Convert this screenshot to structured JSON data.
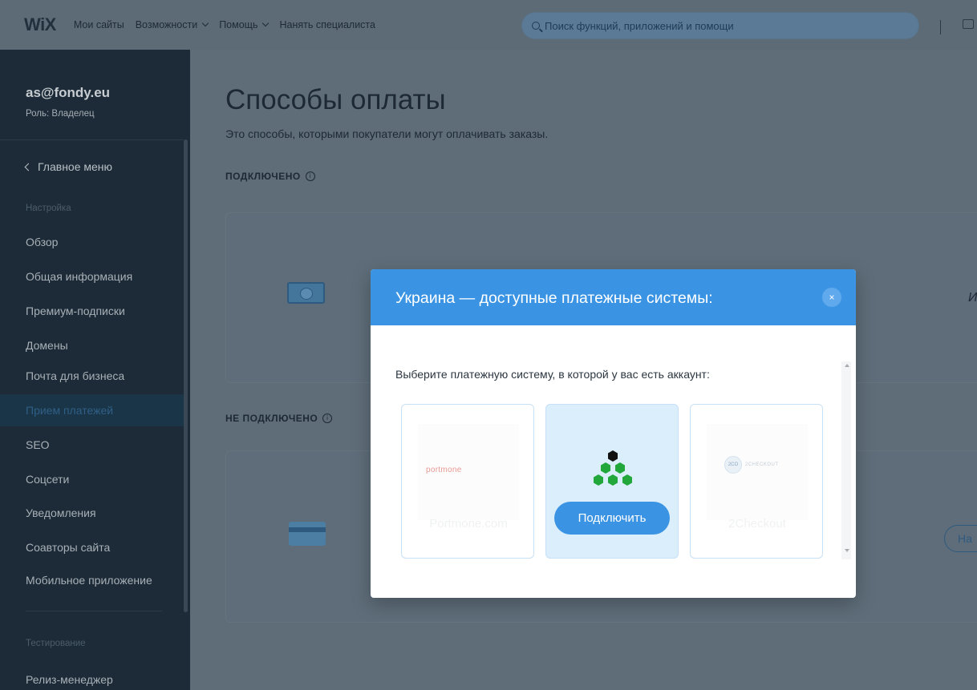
{
  "topbar": {
    "logo": "WiX",
    "nav": [
      "Мои сайты",
      "Возможности",
      "Помощь",
      "Нанять специалиста"
    ],
    "search_placeholder": "Поиск функций, приложений и помощи"
  },
  "sidebar": {
    "email": "as@fondy.eu",
    "role": "Роль: Владелец",
    "back": "Главное меню",
    "section_settings": "Настройка",
    "items": [
      "Обзор",
      "Общая информация",
      "Премиум-подписки",
      "Домены",
      "Почта для бизнеса",
      "Прием платежей",
      "SEO",
      "Соцсети",
      "Уведомления",
      "Соавторы сайта",
      "Мобильное приложение"
    ],
    "active_item": "Прием платежей",
    "section_testing": "Тестирование",
    "release_manager": "Релиз-менеджер"
  },
  "main": {
    "title": "Способы оплаты",
    "description": "Это способы, которыми покупатели могут оплачивать заказы.",
    "connected_label": "ПОДКЛЮЧЕНО",
    "not_connected_label": "НЕ ПОДКЛЮЧЕНО",
    "card1_cut_text": "И",
    "card2_cut_button": "На"
  },
  "modal": {
    "title": "Украина — доступные платежные системы:",
    "close": "×",
    "instruction": "Выберите платежную систему, в которой у вас есть аккаунт:",
    "providers": [
      {
        "name": "Portmone.com",
        "logo_text": "portmone"
      },
      {
        "name": "Fondy",
        "button": "Подключить"
      },
      {
        "name": "2Checkout",
        "logo_text": "2CHECKOUT",
        "logo_circle": "2CO"
      }
    ]
  },
  "colors": {
    "accent": "#3b94e3",
    "sidebar_bg": "#1c2b37",
    "overlay_bg": "#5f6d79",
    "fondy_green": "#22a73a"
  },
  "icons": {
    "search": "search-icon",
    "info": "info-icon",
    "close": "close-icon",
    "cash": "cash-icon",
    "credit_card": "credit-card-icon"
  }
}
